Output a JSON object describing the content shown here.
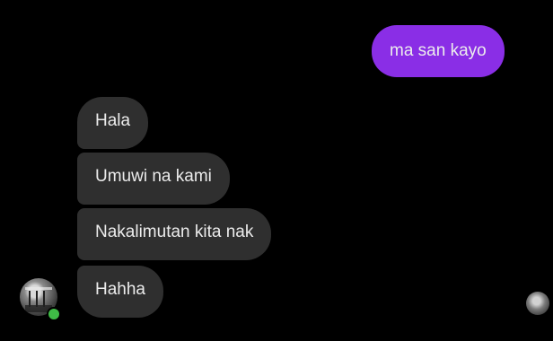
{
  "conversation": {
    "sent": [
      {
        "text": "ma san kayo"
      }
    ],
    "received": [
      {
        "text": "Hala"
      },
      {
        "text": "Umuwi na kami"
      },
      {
        "text": "Nakalimutan kita nak"
      },
      {
        "text": "Hahha"
      }
    ]
  },
  "colors": {
    "background": "#000000",
    "sent_bubble": "#8a2ee6",
    "received_bubble": "#2f2f2f",
    "text": "#ececec",
    "online": "#3fbb46"
  },
  "icons": {
    "contact_avatar": "avatar-photo-icon",
    "online_status": "online-dot-icon",
    "seen_receipt": "seen-avatar-icon"
  }
}
